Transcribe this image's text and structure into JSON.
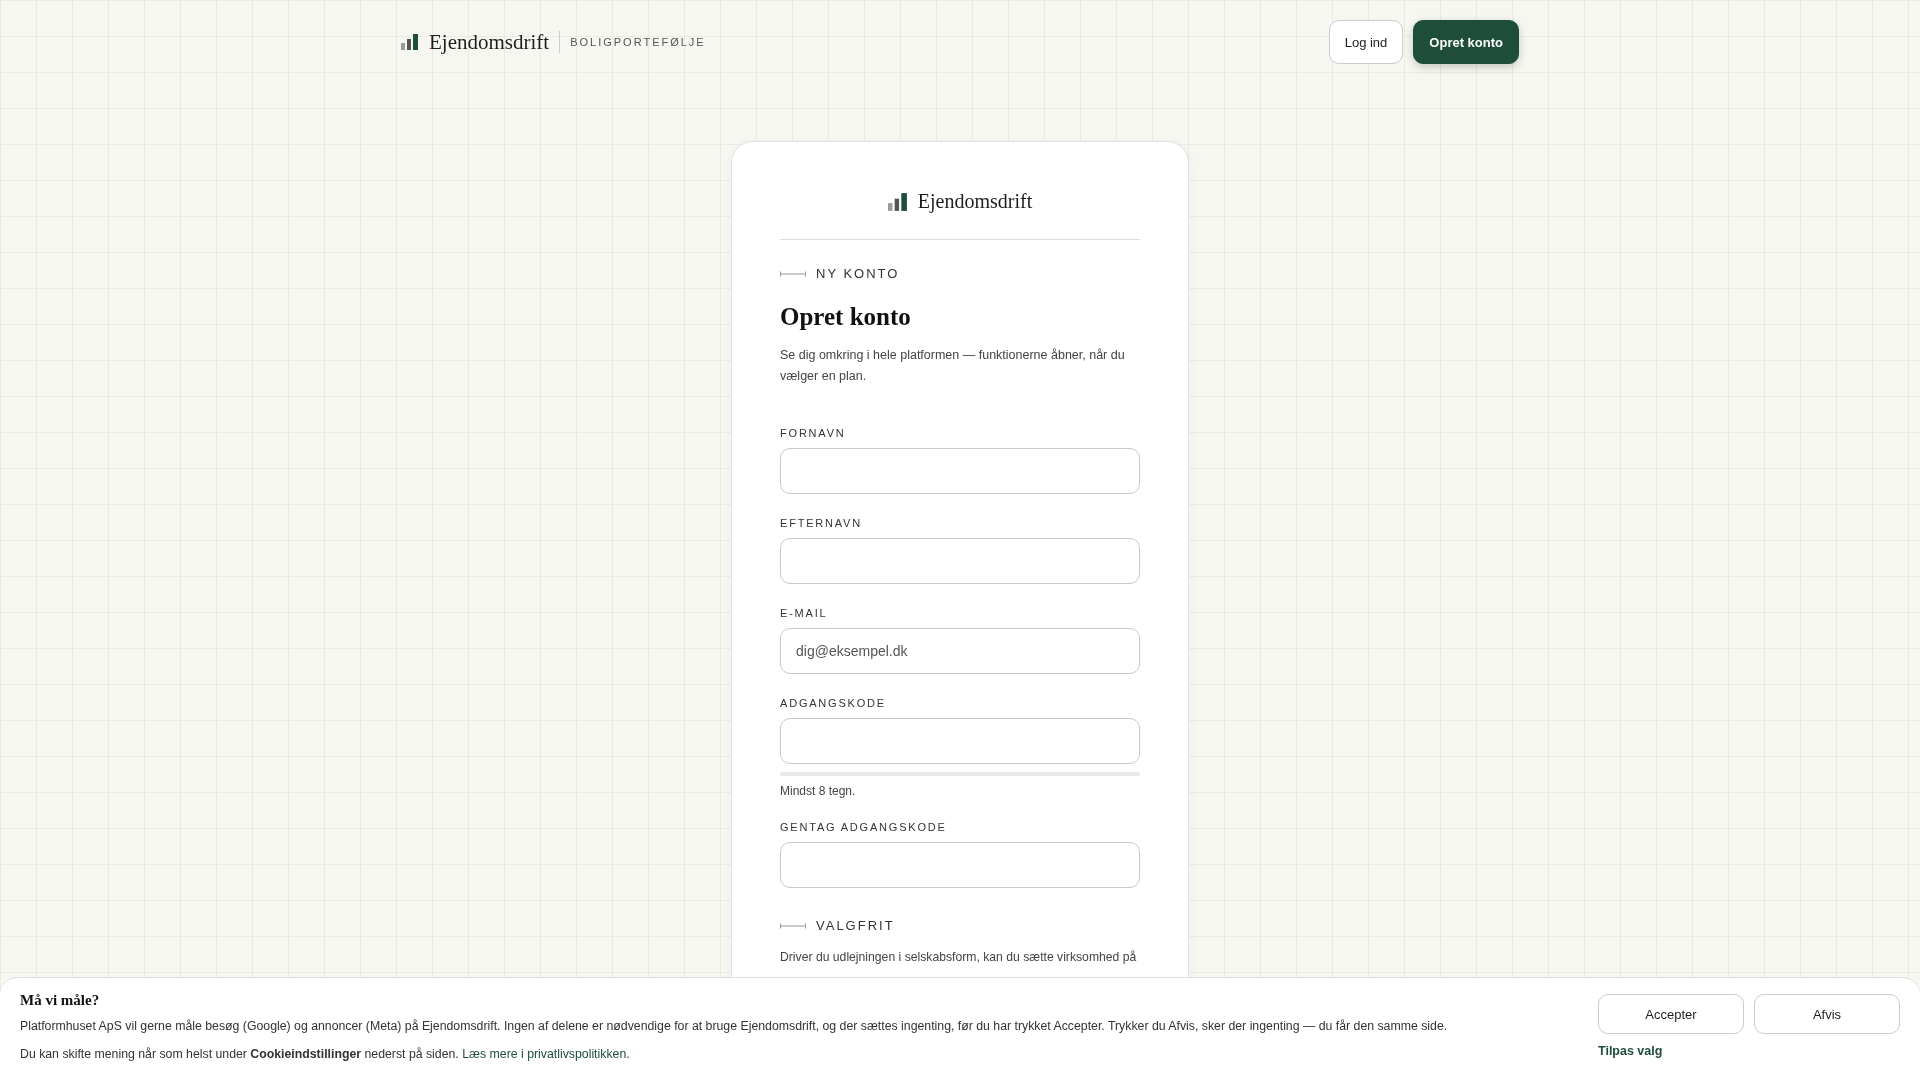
{
  "header": {
    "brand": "Ejendomsdrift",
    "tagline": "BOLIGPORTEFØLJE",
    "buttons": [
      {
        "label": "Log ind",
        "kind": "outline"
      },
      {
        "label": "Opret konto",
        "kind": "primary"
      }
    ]
  },
  "card": {
    "brand": "Ejendomsdrift",
    "eyebrow": "NY KONTO",
    "title": "Opret konto",
    "intro": "Se dig omkring i hele platformen — funktionerne åbner, når du vælger en plan.",
    "fields": [
      {
        "label": "FORNAVN"
      },
      {
        "label": "EFTERNAVN"
      },
      {
        "label": "E-MAIL",
        "placeholder": "dig@eksempel.dk"
      },
      {
        "label": "ADGANGSKODE",
        "strength": {
          "level": 0
        },
        "hint": "Mindst 8 tegn."
      },
      {
        "label": "GENTAG ADGANGSKODE"
      }
    ],
    "optional_eyebrow": "VALGFRIT",
    "optional_text": "Driver du udlejningen i selskabsform, kan du sætte virksomhed på"
  },
  "cookie_banner": {
    "title": "Må vi måle?",
    "text": "Platformhuset ApS vil gerne måle besøg (Google) og annoncer (Meta) på Ejendomsdrift. Ingen af delene er nødvendige for at bruge Ejendomsdrift, og der sættes ingenting, før du har trykket Accepter. Trykker du Afvis, sker der ingenting — du får den samme side.",
    "note": "Du kan skifte mening når som helst under **Cookieindstillinger** nederst på siden.",
    "link": "Læs mere i privatlivspolitikken.",
    "buttons": [
      "Accepter",
      "Afvis"
    ],
    "customize": "Tilpas valg"
  }
}
